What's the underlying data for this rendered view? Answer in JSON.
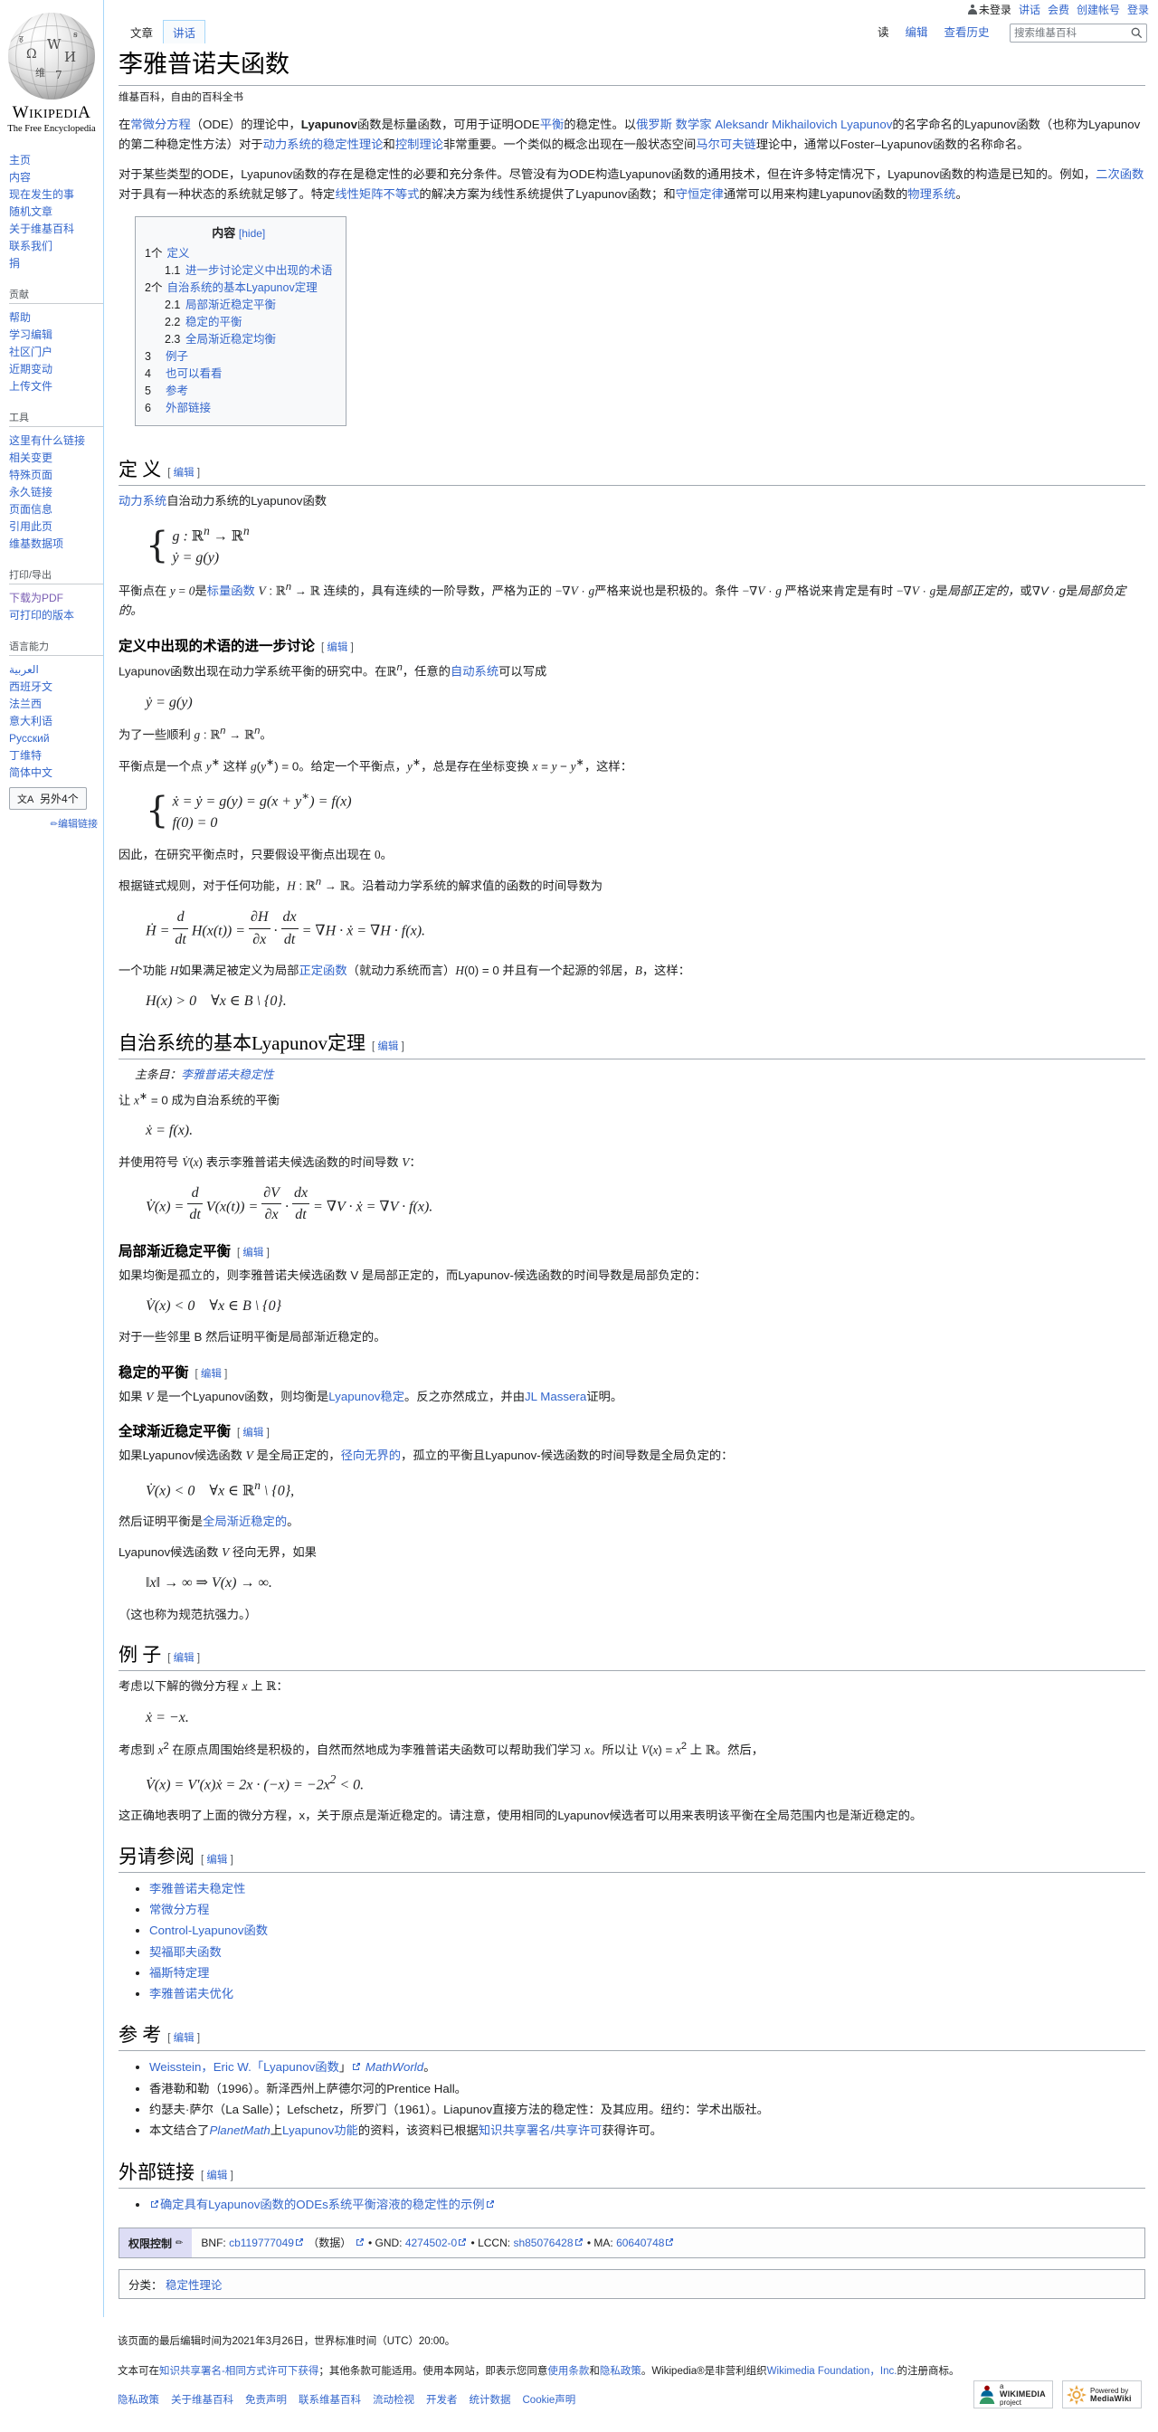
{
  "personal": {
    "not_logged_in": "未登录",
    "items": [
      "讲话",
      "会费",
      "创建帐号",
      "登录"
    ]
  },
  "logo": {
    "wordmark_main": "W",
    "wordmark_rest": "IKIPEDI",
    "wordmark_a": "A",
    "tagline": "The Free Encyclopedia"
  },
  "sidebar": {
    "nav": [
      {
        "label": "主页"
      },
      {
        "label": "内容"
      },
      {
        "label": "现在发生的事"
      },
      {
        "label": "随机文章"
      },
      {
        "label": "关于维基百科"
      },
      {
        "label": "联系我们"
      },
      {
        "label": "捐"
      }
    ],
    "contribute_heading": "贡献",
    "contribute": [
      {
        "label": "帮助"
      },
      {
        "label": "学习编辑"
      },
      {
        "label": "社区门户"
      },
      {
        "label": "近期变动"
      },
      {
        "label": "上传文件"
      }
    ],
    "tools_heading": "工具",
    "tools": [
      {
        "label": "这里有什么链接"
      },
      {
        "label": "相关变更"
      },
      {
        "label": "特殊页面"
      },
      {
        "label": "永久链接"
      },
      {
        "label": "页面信息"
      },
      {
        "label": "引用此页"
      },
      {
        "label": "维基数据项"
      }
    ],
    "print_heading": "打印/导出",
    "print": [
      {
        "label": "下载为PDF",
        "visited": true
      },
      {
        "label": "可打印的版本"
      }
    ],
    "lang_heading": "语言能力",
    "languages": [
      {
        "label": "العربية"
      },
      {
        "label": "西班牙文"
      },
      {
        "label": "法兰西"
      },
      {
        "label": "意大利语"
      },
      {
        "label": "Русский"
      },
      {
        "label": "丁维特"
      },
      {
        "label": "简体中文"
      }
    ],
    "more_lang_button": "另外4个",
    "edit_links": "编辑链接"
  },
  "tabs": {
    "left": [
      {
        "label": "文章",
        "active": true
      },
      {
        "label": "讲话",
        "active": false
      }
    ],
    "right": [
      {
        "label": "读",
        "active": true
      },
      {
        "label": "编辑",
        "active": false
      },
      {
        "label": "查看历史",
        "active": false
      }
    ]
  },
  "search": {
    "placeholder": "搜索维基百科",
    "value": ""
  },
  "article": {
    "title": "李雅普诺夫函数",
    "sitesub": "维基百科，自由的百科全书",
    "lead_p1_parts": [
      {
        "t": "在",
        "k": "plain"
      },
      {
        "t": "常微分方程",
        "k": "link"
      },
      {
        "t": "（ODE）的理论中，",
        "k": "plain"
      },
      {
        "t": "Lyapunov",
        "k": "bold"
      },
      {
        "t": "函数是标量函数，可用于证明ODE",
        "k": "plain"
      },
      {
        "t": "平衡",
        "k": "link"
      },
      {
        "t": "的稳定性。以",
        "k": "plain"
      },
      {
        "t": "俄罗斯",
        "k": "link"
      },
      {
        "t": " ",
        "k": "plain"
      },
      {
        "t": "数学家",
        "k": "link"
      },
      {
        "t": " ",
        "k": "plain"
      },
      {
        "t": "Aleksandr Mikhailovich Lyapunov",
        "k": "link"
      },
      {
        "t": "的名字命名的Lyapunov函数（也称为Lyapunov的第二种稳定性方法）对于",
        "k": "plain"
      },
      {
        "t": "动力系统的稳定性理论",
        "k": "link"
      },
      {
        "t": "和",
        "k": "plain"
      },
      {
        "t": "控制理论",
        "k": "link"
      },
      {
        "t": "非常重要。一个类似的概念出现在一般状态空间",
        "k": "plain"
      },
      {
        "t": "马尔可夫链",
        "k": "link"
      },
      {
        "t": "理论中，通常以Foster–Lyapunov函数的名称命名。",
        "k": "plain"
      }
    ],
    "lead_p2_parts": [
      {
        "t": "对于某些类型的ODE，Lyapunov函数的存在是稳定性的必要和充分条件。尽管没有为ODE构造Lyapunov函数的通用技术，但在许多特定情况下，Lyapunov函数的构造是已知的。例如，",
        "k": "plain"
      },
      {
        "t": "二次函数",
        "k": "link"
      },
      {
        "t": "对于具有一种状态的系统就足够了。特定",
        "k": "plain"
      },
      {
        "t": "线性矩阵不等式",
        "k": "link"
      },
      {
        "t": "的解决方案为线性系统提供了Lyapunov函数；和",
        "k": "plain"
      },
      {
        "t": "守恒定律",
        "k": "link"
      },
      {
        "t": "通常可以用来构建Lyapunov函数的",
        "k": "plain"
      },
      {
        "t": "物理系统",
        "k": "link"
      },
      {
        "t": "。",
        "k": "plain"
      }
    ]
  },
  "toc": {
    "title": "内容",
    "toggle": "[hide]",
    "items": [
      {
        "num": "1个",
        "text": "定义",
        "level": 1
      },
      {
        "num": "1.1",
        "text": "进一步讨论定义中出现的术语",
        "level": 2
      },
      {
        "num": "2个",
        "text": "自治系统的基本Lyapunov定理",
        "level": 1
      },
      {
        "num": "2.1",
        "text": "局部渐近稳定平衡",
        "level": 2
      },
      {
        "num": "2.2",
        "text": "稳定的平衡",
        "level": 2
      },
      {
        "num": "2.3",
        "text": "全局渐近稳定均衡",
        "level": 2
      },
      {
        "num": "3",
        "text": "例子",
        "level": 1
      },
      {
        "num": "4",
        "text": "也可以看看",
        "level": 1
      },
      {
        "num": "5",
        "text": "参考",
        "level": 1
      },
      {
        "num": "6",
        "text": "外部链接",
        "level": 1
      }
    ]
  },
  "edit_label": "编辑",
  "sections": {
    "definition": {
      "heading": "定 义",
      "intro_plain": "自治动力系统的Lyapunov函数",
      "intro_link": "动力系统",
      "math_line1": "g : ℝⁿ → ℝⁿ",
      "math_line2": "ẏ = g(y)",
      "para1_a": "平衡点在 ",
      "para1_math1": "y = 0",
      "para1_b": "是",
      "para1_link": "标量函数",
      "para1_math2": "V : ℝⁿ → ℝ",
      "para1_c": " 连续的，具有连续的一阶导数，严格为正的 ",
      "para1_math3": "−∇V · g",
      "para1_d": "严格来说也是积极的。条件 ",
      "para1_math4": "−∇V · g",
      "para1_e": " 严格说来肯定是有时 ",
      "para1_math5": "−∇V · g",
      "para1_f": "是局部正定的，或",
      "para1_math6": "∇V · g",
      "para1_g": "是局部负定的。"
    },
    "further": {
      "heading": "定义中出现的术语的进一步讨论",
      "p1_a": "Lyapunov函数出现在动力学系统平衡的研究中。在ℝⁿ，任意的",
      "p1_link": "自动系统",
      "p1_b": "可以写成",
      "math1": "ẏ = g(y)",
      "p2": "为了一些顺利 g : ℝⁿ → ℝⁿ。",
      "p3": "平衡点是一个点 y* 这样 g(y*) = 0。给定一个平衡点，y*，总是存在坐标变换 x = y − y*，这样：",
      "math2_l1": "ẋ = ẏ = g(y) = g(x + y*) = f(x)",
      "math2_l2": "f(0) = 0",
      "p4": "因此，在研究平衡点时，只要假设平衡点出现在 0。",
      "p5": "根据链式规则，对于任何功能，H : ℝⁿ → ℝ。沿着动力学系统的解求值的函数的时间导数为",
      "math3": "Ḣ = d/dt H(x(t)) = ∂H/∂x · dx/dt = ∇H · ẋ = ∇H · f(x).",
      "p6_a": "一个功能 H 如果满足被定义为局部",
      "p6_link": "正定函数",
      "p6_b": "（就动力系统而言）H(0) = 0 并且有一个起源的邻居，B，这样：",
      "math4": "H(x) > 0   ∀x ∈ B \\ {0}."
    },
    "basic": {
      "heading": "自治系统的基本Lyapunov定理",
      "main_label": "主条目：",
      "main_link": "李雅普诺夫稳定性",
      "p1_a": "让 ",
      "p1_math": "x* = 0",
      "p1_b": " 成为自治系统的平衡",
      "math1": "ẋ = f(x).",
      "p2_a": "并使用符号 ",
      "p2_math": "V̇(x)",
      "p2_b": " 表示李雅普诺夫候选函数的时间导数 ",
      "p2_math2": "V",
      "p2_c": "：",
      "math2": "V̇(x) = d/dt V(x(t)) = ∂V/∂x · dx/dt = ∇V · ẋ = ∇V · f(x)."
    },
    "local": {
      "heading": "局部渐近稳定平衡",
      "p1": "如果均衡是孤立的，则李雅普诺夫候选函数 V 是局部正定的，而Lyapunov-候选函数的时间导数是局部负定的：",
      "math1": "V̇(x) < 0   ∀x ∈ B \\ {0}",
      "p2": "对于一些邻里 B 然后证明平衡是局部渐近稳定的。"
    },
    "stable": {
      "heading": "稳定的平衡",
      "p1_a": "如果 ",
      "p1_math": "V",
      "p1_b": " 是一个Lyapunov函数，则均衡是",
      "p1_link1": "Lyapunov稳定",
      "p1_c": "。反之亦然成立，并由",
      "p1_link2": "JL Massera",
      "p1_d": "证明。"
    },
    "global": {
      "heading": "全球渐近稳定平衡",
      "p1_a": "如果Lyapunov候选函数 V 是全局正定的，",
      "p1_link": "径向无界的",
      "p1_b": "，孤立的平衡且Lyapunov-候选函数的时间导数是全局负定的：",
      "math1": "V̇(x) < 0   ∀x ∈ ℝⁿ \\ {0},",
      "p2_a": "然后证明平衡是",
      "p2_link": "全局渐近稳定的",
      "p2_b": "。",
      "p3": "Lyapunov候选函数 V 径向无界，如果",
      "math2": "‖x‖ → ∞ ⇒ V(x) → ∞.",
      "p4": "（这也称为规范抗强力。）"
    },
    "examples": {
      "heading": "例 子",
      "p1": "考虑以下解的微分方程 x 上 ℝ：",
      "math1": "ẋ = −x.",
      "p2": "考虑到 x² 在原点周围始终是积极的，自然而然地成为李雅普诺夫函数可以帮助我们学习 x。所以让 V(x) = x² 上 ℝ。然后，",
      "math2": "V̇(x) = V'(x)ẋ = 2x · (−x) = −2x² < 0.",
      "p3": "这正确地表明了上面的微分方程，x，关于原点是渐近稳定的。请注意，使用相同的Lyapunov候选者可以用来表明该平衡在全局范围内也是渐近稳定的。"
    },
    "seealso": {
      "heading": "另请参阅",
      "items": [
        "李雅普诺夫稳定性",
        "常微分方程",
        "Control-Lyapunov函数",
        "契福耶夫函数",
        "福斯特定理",
        "李雅普诺夫优化"
      ]
    },
    "references": {
      "heading": "参 考",
      "items": [
        {
          "parts": [
            {
              "t": "Weisstein，Eric W.「Lyapunov函数",
              "k": "link"
            },
            {
              "t": "」",
              "k": "plain"
            },
            {
              "t": "ext",
              "k": "ext"
            },
            {
              "t": " ",
              "k": "plain"
            },
            {
              "t": "MathWorld",
              "k": "linkitalic"
            },
            {
              "t": "。",
              "k": "plain"
            }
          ]
        },
        {
          "parts": [
            {
              "t": "香港勒和勒（1996）。新泽西州上萨德尔河的Prentice Hall。",
              "k": "plain"
            }
          ]
        },
        {
          "parts": [
            {
              "t": "约瑟夫·萨尔（La Salle）；Lefschetz，所罗门（1961）。Liapunov直接方法的稳定性：及其应用。纽约：学术出版社。",
              "k": "plain"
            }
          ]
        },
        {
          "parts": [
            {
              "t": "本文结合了",
              "k": "plain"
            },
            {
              "t": "PlanetMath",
              "k": "linkitalic"
            },
            {
              "t": "上",
              "k": "plain"
            },
            {
              "t": "Lyapunov功能",
              "k": "link"
            },
            {
              "t": "的资料，该资料已根据",
              "k": "plain"
            },
            {
              "t": "知识共享署名/共享许可",
              "k": "link"
            },
            {
              "t": "获得许可。",
              "k": "plain"
            }
          ]
        }
      ]
    },
    "external": {
      "heading": "外部链接",
      "item_a": "确定具有Lyapunov函数的ODEs系统平衡溶液的稳定性的",
      "item_link": "示例"
    }
  },
  "authority": {
    "title": "权限控制",
    "entries": [
      {
        "label": "BNF:",
        "value": "cb119777049",
        "extra": "（数据）"
      },
      {
        "label": "GND:",
        "value": "4274502-0"
      },
      {
        "label": "LCCN:",
        "value": "sh85076428"
      },
      {
        "label": "MA:",
        "value": "60640748"
      }
    ]
  },
  "categories": {
    "label": "分类：",
    "items": [
      "稳定性理论"
    ]
  },
  "footer": {
    "lastmod": "该页面的最后编辑时间为2021年3月26日，世界标准时间（UTC）20:00。",
    "license_parts": [
      {
        "t": "文本可在",
        "k": "plain"
      },
      {
        "t": "知识共享署名-相同方式许可下获得",
        "k": "link"
      },
      {
        "t": "；其他条款可能适用。使用本网站，即表示您同意",
        "k": "plain"
      },
      {
        "t": "使用条款",
        "k": "link"
      },
      {
        "t": "和",
        "k": "plain"
      },
      {
        "t": "隐私政策",
        "k": "link"
      },
      {
        "t": "。Wikipedia®是非营利组织",
        "k": "plain"
      },
      {
        "t": "Wikimedia Foundation，Inc.",
        "k": "link"
      },
      {
        "t": "的注册商标。",
        "k": "plain"
      }
    ],
    "links": [
      "隐私政策",
      "关于维基百科",
      "免责声明",
      "联系维基百科",
      "流动检视",
      "开发者",
      "统计数据",
      "Cookie声明"
    ],
    "badge_wikimedia_top": "a",
    "badge_wikimedia_main": "WIKIMEDIA",
    "badge_wikimedia_sub": "project",
    "badge_mediawiki_top": "Powered by",
    "badge_mediawiki_main": "MediaWiki"
  },
  "colors": {
    "link": "#3366cc",
    "border": "#a2a9b1",
    "tab_border": "#a7d7f9",
    "navbox_title_bg": "#ddddf5"
  }
}
